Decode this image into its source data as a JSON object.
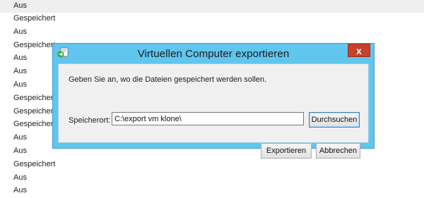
{
  "background_list": [
    "Aus",
    "Gespeichert",
    "Aus",
    "Gespeichert",
    "Aus",
    "Aus",
    "Aus",
    "Gespeichert",
    "Gespeichert",
    "Gespeichert",
    "Aus",
    "Aus",
    "Gespeichert",
    "Aus",
    "Aus"
  ],
  "dialog": {
    "title": "Virtuellen Computer exportieren",
    "close_label": "x",
    "app_icon": "export-vm-icon",
    "instruction": "Geben Sie an, wo die Dateien gespeichert werden sollen.",
    "location_label": "Speicherort:",
    "location_value": "C:\\export vm klone\\",
    "browse_label": "Durchsuchen",
    "export_label": "Exportieren",
    "cancel_label": "Abbrechen"
  },
  "colors": {
    "dialog_frame": "#60c6ee",
    "close_button": "#c7402b",
    "client_background": "#f0f0f0"
  }
}
